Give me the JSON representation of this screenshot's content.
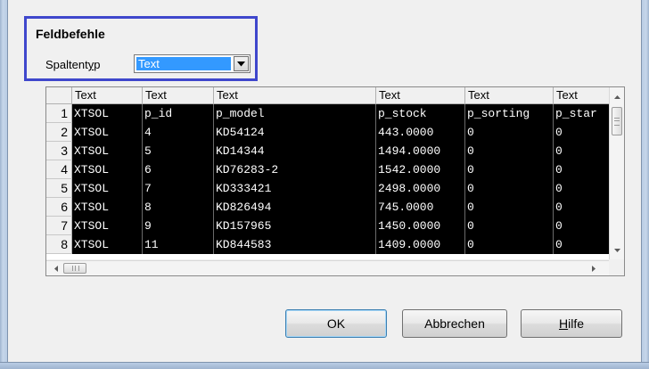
{
  "group": {
    "title": "Feldbefehle",
    "column_type_label": "Spaltentyp",
    "column_type_value": "Text"
  },
  "table": {
    "columns": [
      "Text",
      "Text",
      "Text",
      "Text",
      "Text",
      "Text"
    ],
    "rows": [
      {
        "num": "1",
        "cells": [
          "XTSOL",
          "p_id",
          "p_model",
          "p_stock",
          "p_sorting",
          "p_star"
        ]
      },
      {
        "num": "2",
        "cells": [
          "XTSOL",
          "4",
          "KD54124",
          "443.0000",
          "0",
          "0"
        ]
      },
      {
        "num": "3",
        "cells": [
          "XTSOL",
          "5",
          "KD14344",
          "1494.0000",
          "0",
          "0"
        ]
      },
      {
        "num": "4",
        "cells": [
          "XTSOL",
          "6",
          "KD76283-2",
          "1542.0000",
          "0",
          "0"
        ]
      },
      {
        "num": "5",
        "cells": [
          "XTSOL",
          "7",
          "KD333421",
          "2498.0000",
          "0",
          "0"
        ]
      },
      {
        "num": "6",
        "cells": [
          "XTSOL",
          "8",
          "KD826494",
          "745.0000",
          "0",
          "0"
        ]
      },
      {
        "num": "7",
        "cells": [
          "XTSOL",
          "9",
          "KD157965",
          "1450.0000",
          "0",
          "0"
        ]
      },
      {
        "num": "8",
        "cells": [
          "XTSOL",
          "11",
          "KD844583",
          "1409.0000",
          "0",
          "0"
        ]
      }
    ]
  },
  "buttons": {
    "ok": "OK",
    "cancel": "Abbrechen",
    "help": "Hilfe"
  },
  "colors": {
    "highlight": "#3399ff",
    "group_border": "#3f47cc",
    "cell_background": "#000000"
  }
}
